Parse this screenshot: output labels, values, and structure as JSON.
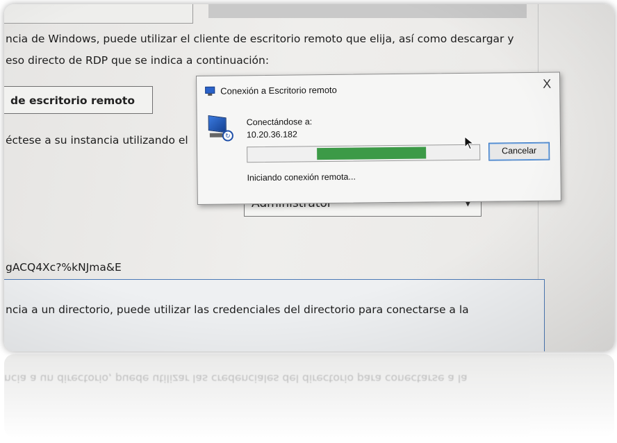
{
  "page": {
    "intro_line1": "ncia de Windows, puede utilizar el cliente de escritorio remoto que elija, así como descargar y",
    "intro_line2": "eso directo de RDP que se indica a continuación:",
    "rdp_button": "de escritorio remoto",
    "connect_text": "éctese a su instancia utilizando el",
    "username_value": "Administrator",
    "password_text": "gACQ4Xc?%kNJma&E",
    "directory_note": "ncia a un directorio, puede utilizar las credenciales del directorio para conectarse a la"
  },
  "dialog": {
    "title": "Conexión a Escritorio remoto",
    "close_label": "X",
    "connecting_label": "Conectándose a:",
    "address": "10.20.36.182",
    "progress": {
      "start": 0.3,
      "end": 0.77
    },
    "cancel_label": "Cancelar",
    "status": "Iniciando conexión remota..."
  },
  "reflection": {
    "text": "ncia a un directorio, puede utilizar las credenciales del directorio para conectarse a la"
  },
  "colors": {
    "progress_fill": "#3c9a47",
    "info_border": "#4a78b5",
    "button_focus": "#2a6ec0"
  },
  "icons": [
    "remote-desktop-icon",
    "close-icon",
    "chevron-down-icon",
    "cursor-icon"
  ]
}
